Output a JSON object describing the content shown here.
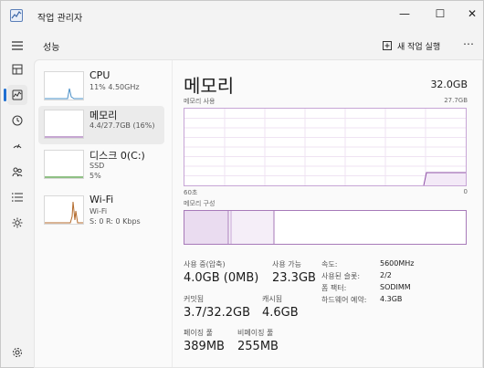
{
  "window": {
    "title": "작업 관리자",
    "controls": {
      "minimize": "—",
      "maximize": "☐",
      "close": "✕"
    }
  },
  "rail": {
    "icons": [
      "menu-icon",
      "processes-icon",
      "performance-icon",
      "app-history-icon",
      "startup-icon",
      "users-icon",
      "details-icon",
      "services-icon",
      "settings-icon"
    ]
  },
  "header": {
    "section_title": "성능",
    "new_task_label": "새 작업 실행",
    "more_label": "⋯"
  },
  "devices": [
    {
      "name": "CPU",
      "line1": "11% 4.50GHz",
      "line2": ""
    },
    {
      "name": "메모리",
      "line1": "4.4/27.7GB (16%)",
      "line2": ""
    },
    {
      "name": "디스크 0(C:)",
      "line1": "SSD",
      "line2": "5%"
    },
    {
      "name": "Wi-Fi",
      "line1": "Wi-Fi",
      "line2": "S: 0 R: 0 Kbps"
    }
  ],
  "memory": {
    "title": "메모리",
    "total": "32.0GB",
    "usage_label": "메모리 사용",
    "usage_max": "27.7GB",
    "axis_left": "60초",
    "axis_right": "0",
    "composition_label": "메모리 구성",
    "stats": {
      "in_use_label": "사용 중(압축)",
      "in_use_value": "4.0GB (0MB)",
      "available_label": "사용 가능",
      "available_value": "23.3GB",
      "committed_label": "커밋됨",
      "committed_value": "3.7/32.2GB",
      "cached_label": "캐시됨",
      "cached_value": "4.6GB",
      "paged_label": "페이징 풀",
      "paged_value": "389MB",
      "nonpaged_label": "비페이징 풀",
      "nonpaged_value": "255MB"
    },
    "side": {
      "speed_label": "속도:",
      "speed_value": "5600MHz",
      "slots_label": "사용된 슬롯:",
      "slots_value": "2/2",
      "form_label": "폼 팩터:",
      "form_value": "SODIMM",
      "reserved_label": "하드웨어 예약:",
      "reserved_value": "4.3GB"
    }
  },
  "colors": {
    "accent": "#8e4fa6",
    "graph_fill": "#f3e9f7",
    "rail_indicator": "#1f6fd1"
  }
}
